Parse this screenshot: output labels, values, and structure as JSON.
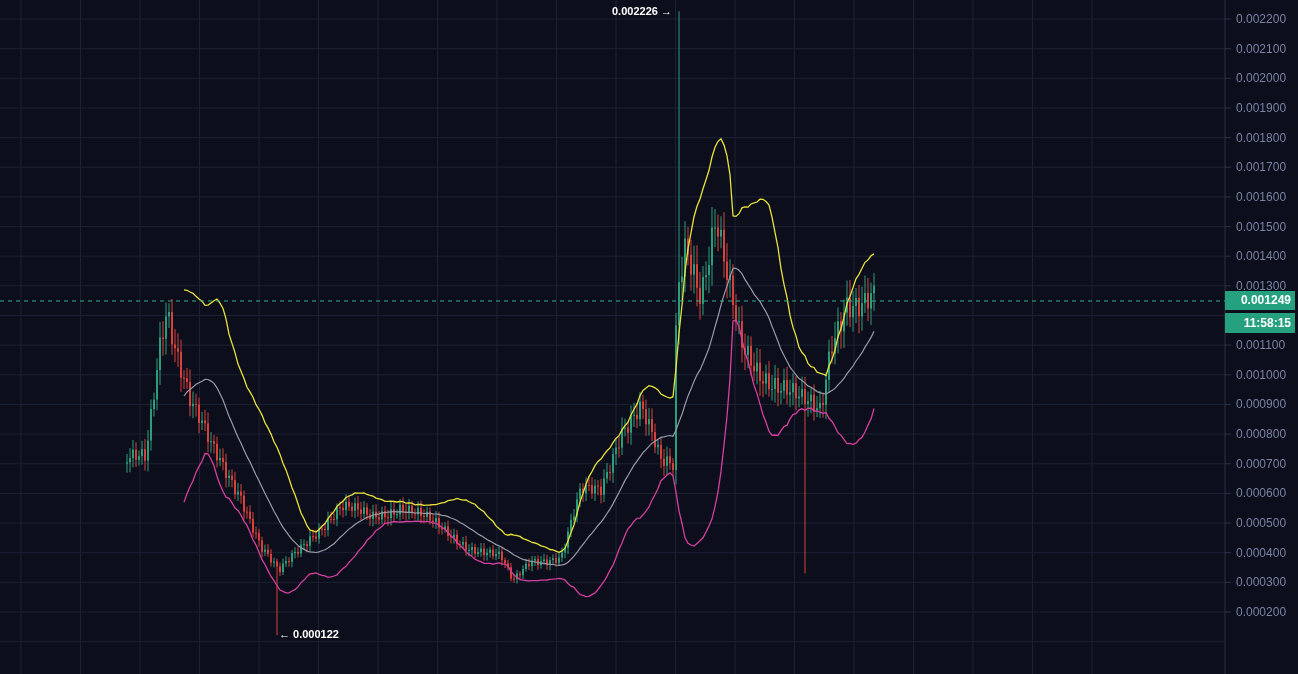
{
  "price_axis": {
    "labels": [
      "0.002200",
      "0.002100",
      "0.002000",
      "0.001900",
      "0.001800",
      "0.001700",
      "0.001600",
      "0.001500",
      "0.001400",
      "0.001300",
      "0.001100",
      "0.001000",
      "0.000900",
      "0.000800",
      "0.000700",
      "0.000600",
      "0.000500",
      "0.000400",
      "0.000300",
      "0.000200"
    ]
  },
  "current_price": {
    "label": "0.001249",
    "countdown": "11:58:15"
  },
  "high_marker": {
    "label": "0.002226 →"
  },
  "low_marker": {
    "label": "← 0.000122"
  }
}
